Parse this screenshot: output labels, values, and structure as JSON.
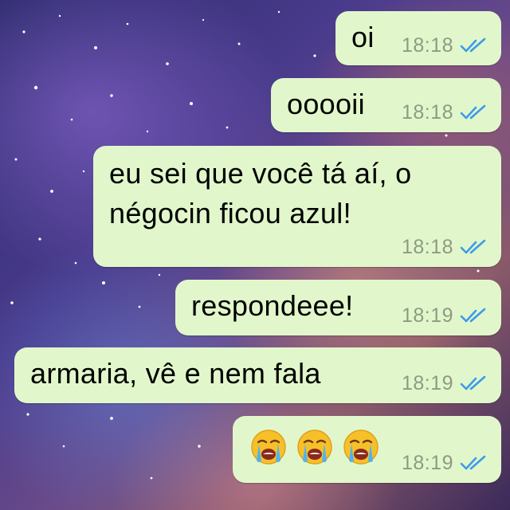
{
  "messages": [
    {
      "text": "oi",
      "time": "18:18",
      "status_icon": "double-check-icon"
    },
    {
      "text": "ooooii",
      "time": "18:18",
      "status_icon": "double-check-icon"
    },
    {
      "text": "eu sei que você tá aí, o négocin ficou azul!",
      "time": "18:18",
      "status_icon": "double-check-icon"
    },
    {
      "text": "respondeee!",
      "time": "18:19",
      "status_icon": "double-check-icon"
    },
    {
      "text": "armaria, vê e nem fala",
      "time": "18:19",
      "status_icon": "double-check-icon"
    },
    {
      "emojis": [
        "loudly-crying-face",
        "loudly-crying-face",
        "loudly-crying-face"
      ],
      "time": "18:19",
      "status_icon": "double-check-icon"
    }
  ],
  "colors": {
    "bubble": "#e1f7cb",
    "timestamp": "#8e9a83",
    "read_ticks": "#3d9be9"
  }
}
